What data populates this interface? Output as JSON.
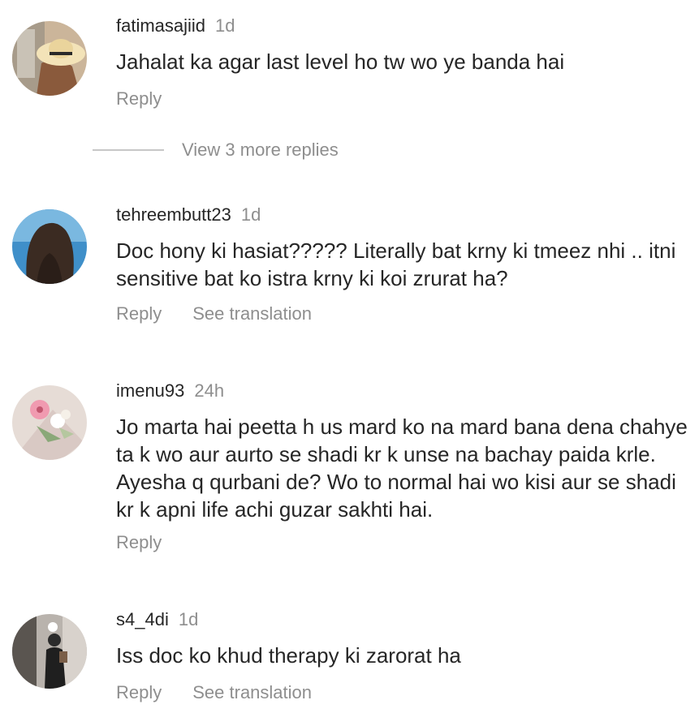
{
  "comments": [
    {
      "username": "fatimasajiid",
      "time": "1d",
      "text": "Jahalat ka agar last level ho tw wo ye banda hai",
      "reply_label": "Reply",
      "avatar_icon": "woman-sunhat-avatar"
    },
    {
      "username": "tehreembutt23",
      "time": "1d",
      "text": "Doc hony ki hasiat????? Literally bat krny ki tmeez nhi .. itni sensitive bat ko istra krny ki koi zrurat ha?",
      "reply_label": "Reply",
      "translate_label": "See translation",
      "avatar_icon": "woman-long-hair-avatar"
    },
    {
      "username": "imenu93",
      "time": "24h",
      "text": "Jo marta hai peetta h us mard ko na mard bana dena chahye ta k wo aur aurto se shadi kr k unse na bachay paida krle. Ayesha q qurbani de? Wo to normal hai wo kisi aur se shadi kr k apni life achi guzar sakhti hai.",
      "reply_label": "Reply",
      "avatar_icon": "flower-bouquet-avatar"
    },
    {
      "username": "s4_4di",
      "time": "1d",
      "text": "Iss doc ko khud therapy ki zarorat ha",
      "reply_label": "Reply",
      "translate_label": "See translation",
      "avatar_icon": "mirror-selfie-avatar"
    }
  ],
  "more_replies": {
    "label": "View 3 more replies"
  }
}
